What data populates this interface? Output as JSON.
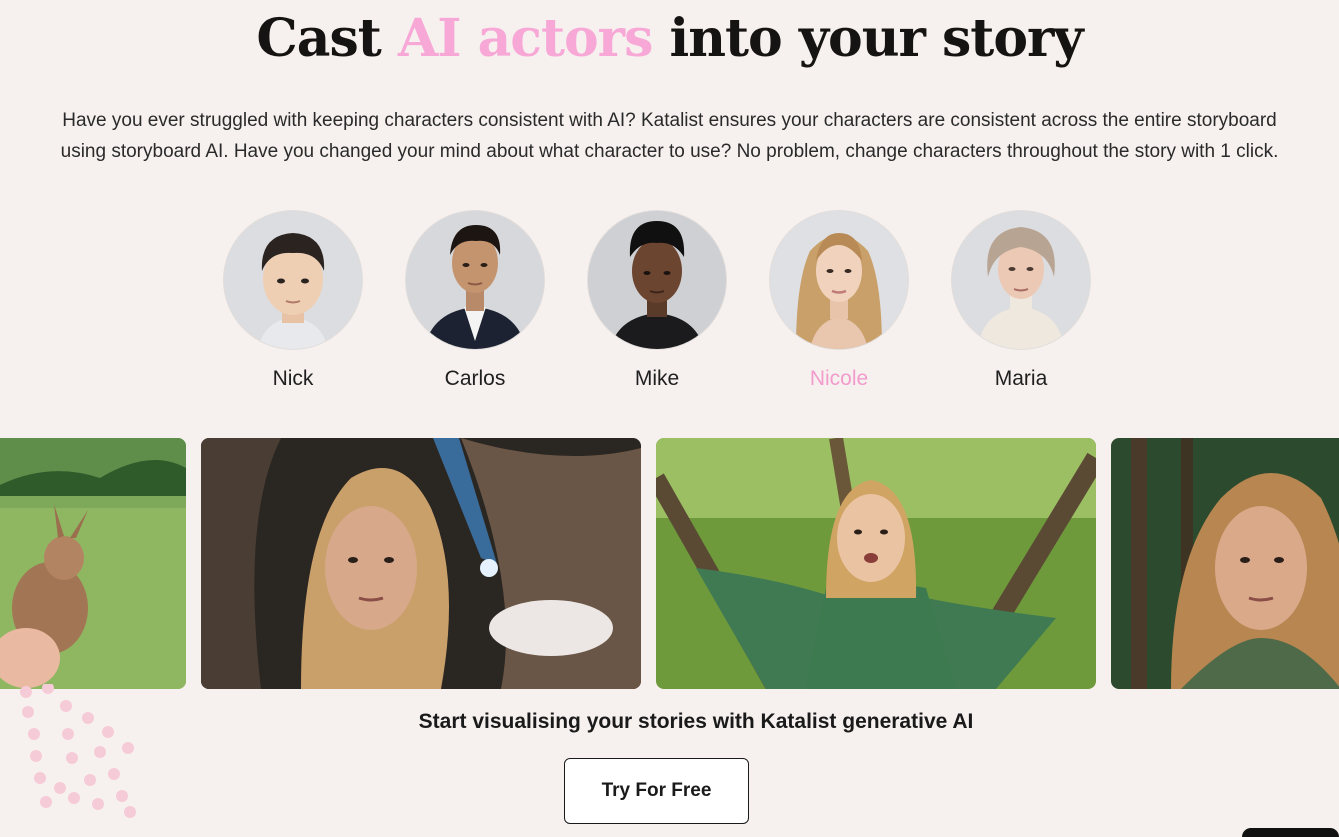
{
  "hero": {
    "title_before": "Cast ",
    "title_accent": "AI actors",
    "title_after": " into your story",
    "accent_color": "#f7a8d6"
  },
  "intro": {
    "line1": "Have you ever struggled with keeping characters consistent with AI? Katalist ensures your characters are consistent across the entire storyboard",
    "line2": "using storyboard AI. Have you changed your mind about what character to use? No problem, change characters throughout the story with 1 click."
  },
  "cast": {
    "selected": "Nicole",
    "selected_color": "#f29bcc",
    "members": [
      {
        "name": "Nick",
        "icon": "boy-portrait"
      },
      {
        "name": "Carlos",
        "icon": "man-suit-portrait"
      },
      {
        "name": "Mike",
        "icon": "young-man-portrait"
      },
      {
        "name": "Nicole",
        "icon": "blonde-woman-portrait"
      },
      {
        "name": "Maria",
        "icon": "elderly-woman-portrait"
      }
    ]
  },
  "scenes": [
    {
      "icon": "rabbit-meadow-image"
    },
    {
      "icon": "cave-crystal-woman-image"
    },
    {
      "icon": "tree-forest-woman-image"
    },
    {
      "icon": "forest-woman-closeup-image"
    }
  ],
  "cta": {
    "text": "Start visualising your stories with Katalist generative AI",
    "button_label": "Try For Free"
  }
}
